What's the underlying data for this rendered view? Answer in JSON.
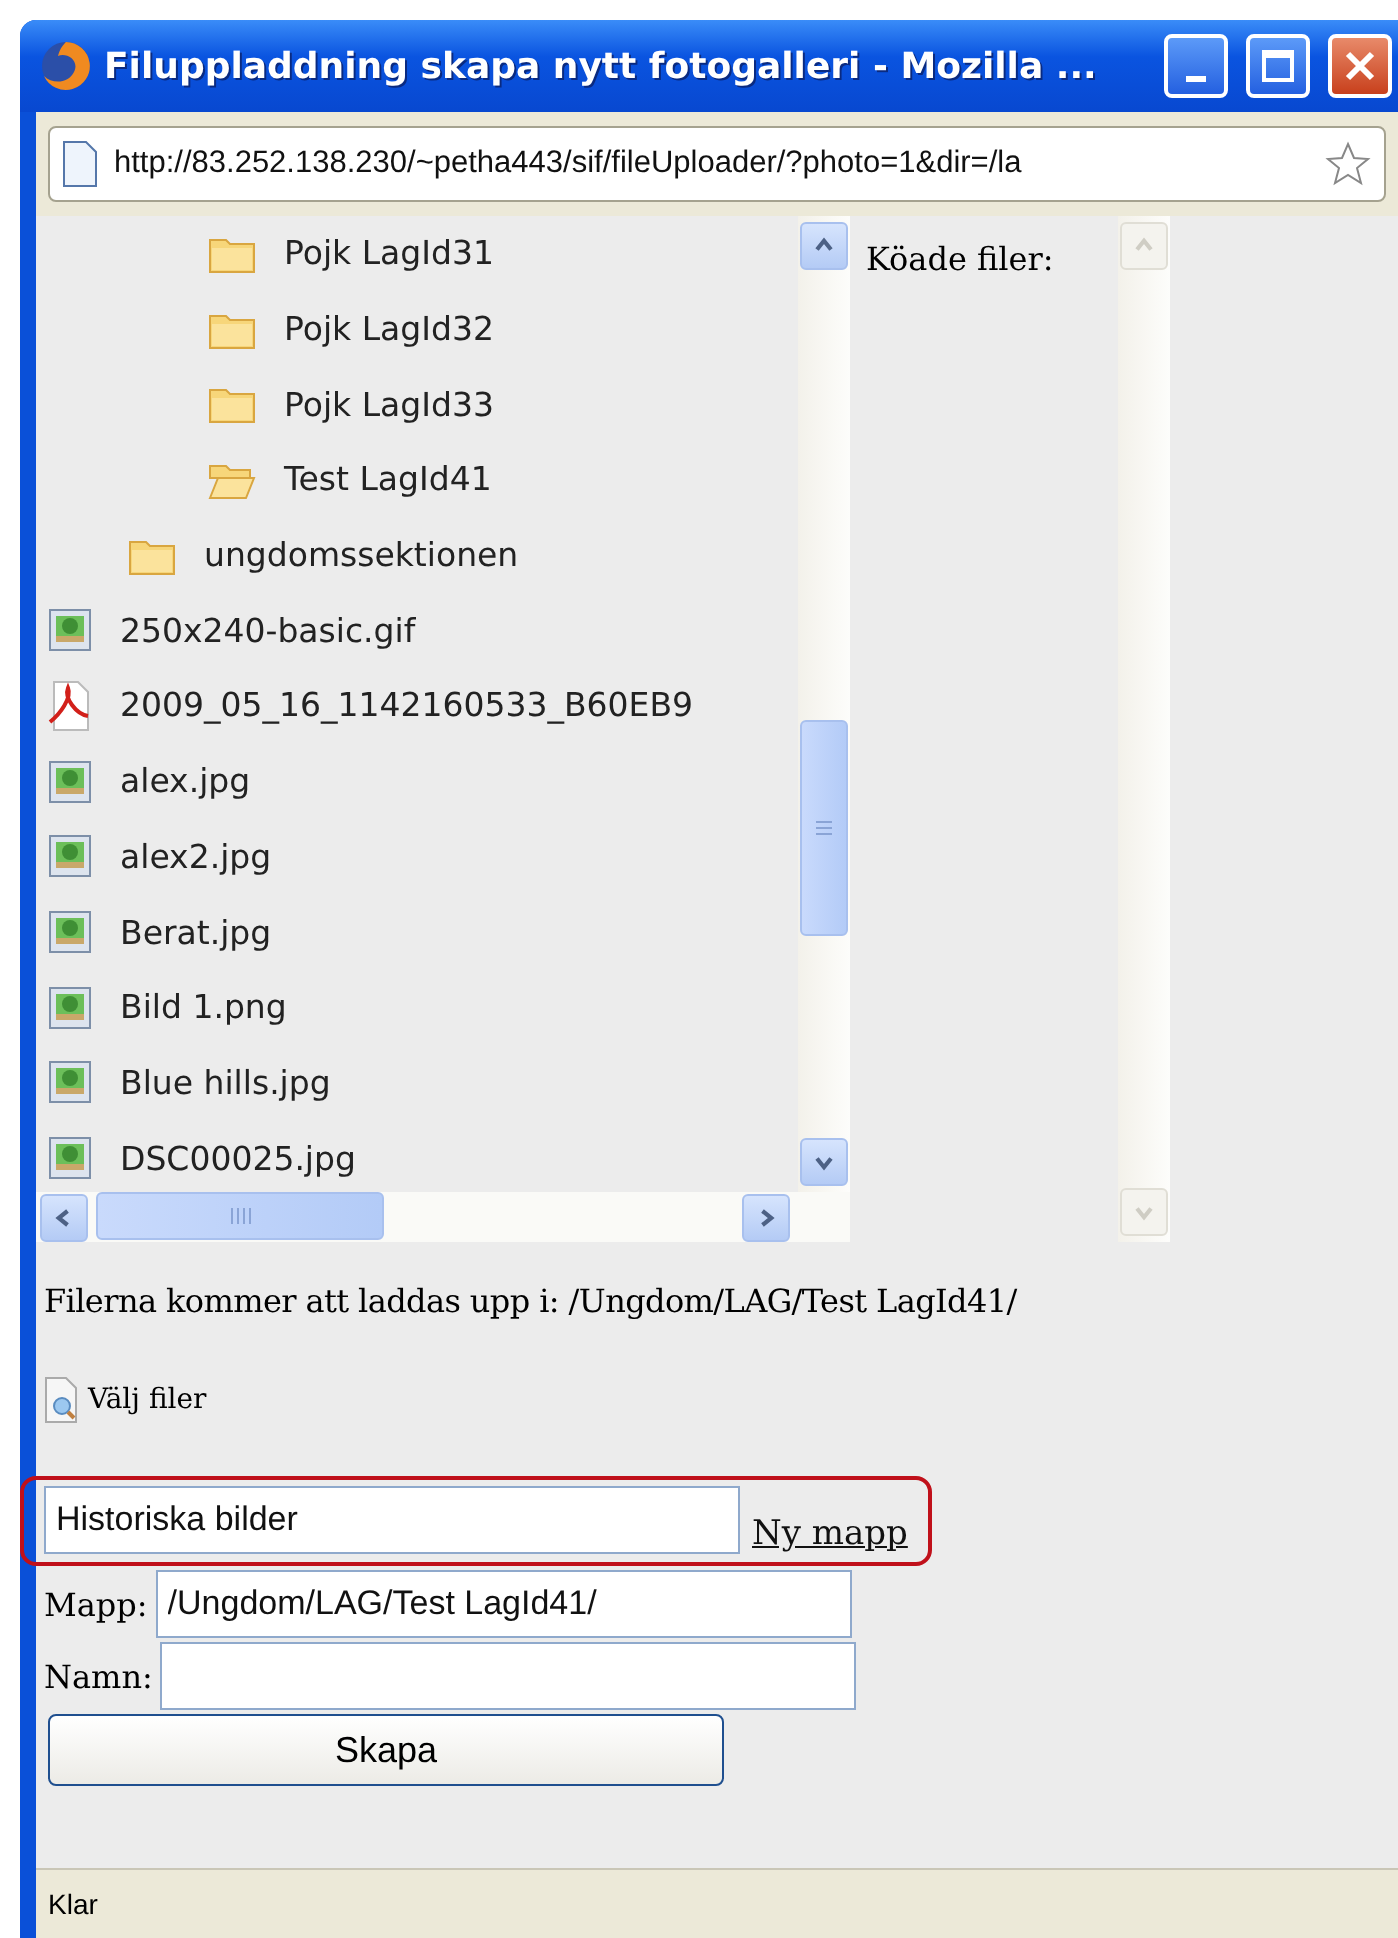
{
  "window": {
    "title": "Filuppladdning skapa nytt fotogalleri - Mozilla ..."
  },
  "address_bar": {
    "url": "http://83.252.138.230/~petha443/sif/fileUploader/?photo=1&dir=/la"
  },
  "tree": [
    {
      "children": [
        {
          "children": [
            {
              "kind": "folder",
              "label": "Pojk LagId31"
            },
            {
              "kind": "folder",
              "label": "Pojk LagId32"
            },
            {
              "kind": "folder",
              "label": "Pojk LagId33"
            },
            {
              "kind": "open-folder",
              "label": "Test LagId41"
            }
          ]
        },
        {
          "kind": "folder",
          "label": "ungdomssektionen"
        }
      ]
    },
    {
      "kind": "image",
      "label": "250x240-basic.gif"
    },
    {
      "kind": "pdf",
      "label": "2009_05_16_1142160533_B60EB9"
    },
    {
      "kind": "image",
      "label": "alex.jpg"
    },
    {
      "kind": "image",
      "label": "alex2.jpg"
    },
    {
      "kind": "image",
      "label": "Berat.jpg"
    },
    {
      "kind": "image",
      "label": "Bild 1.png"
    },
    {
      "kind": "image",
      "label": "Blue hills.jpg"
    },
    {
      "kind": "image",
      "label": "DSC00025.jpg"
    }
  ],
  "queue": {
    "title": "Köade filer:"
  },
  "upload_target": "Filerna kommer att laddas upp i: /Ungdom/LAG/Test LagId41/",
  "choose_files": "Välj filer",
  "new_folder": {
    "value": "Historiska bilder",
    "link": "Ny mapp",
    "highlighted": true
  },
  "folder_field": {
    "label": "Mapp:",
    "value": "/Ungdom/LAG/Test LagId41/"
  },
  "name_field": {
    "label": "Namn:"
  },
  "create_button": "Skapa",
  "status_bar": "Klar"
}
